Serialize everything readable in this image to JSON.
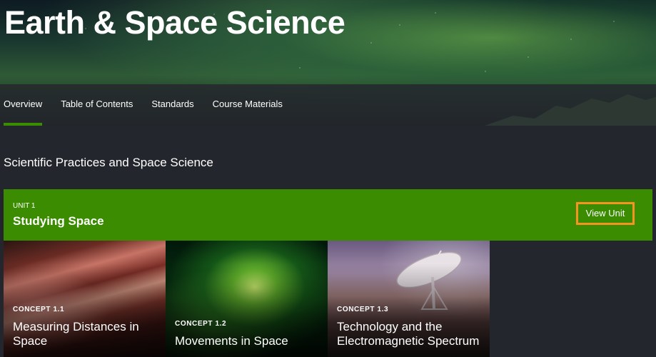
{
  "page": {
    "title": "Earth & Space Science"
  },
  "nav": {
    "tabs": [
      {
        "label": "Overview",
        "active": true
      },
      {
        "label": "Table of Contents",
        "active": false
      },
      {
        "label": "Standards",
        "active": false
      },
      {
        "label": "Course Materials",
        "active": false
      }
    ]
  },
  "section": {
    "title": "Scientific Practices and Space Science"
  },
  "unit": {
    "label": "UNIT 1",
    "title": "Studying Space",
    "button_label": "View Unit"
  },
  "concepts": [
    {
      "label": "CONCEPT 1.1",
      "title": "Measuring Distances in Space",
      "image": "jupiter-surface"
    },
    {
      "label": "CONCEPT 1.2",
      "title": "Movements in Space",
      "image": "green-nebula"
    },
    {
      "label": "CONCEPT 1.3",
      "title": "Technology and the Electromagnetic Spectrum",
      "image": "radio-telescope-dish"
    }
  ],
  "colors": {
    "accent_green": "#3b8c00",
    "focus_orange": "#f7931e",
    "page_background": "#24262d"
  }
}
